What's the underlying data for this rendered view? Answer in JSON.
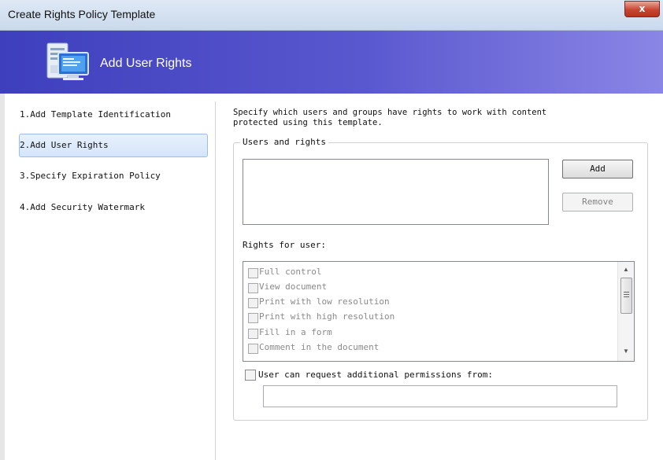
{
  "window": {
    "title": "Create Rights Policy Template",
    "close_label": "x"
  },
  "banner": {
    "title": "Add User Rights",
    "icon": "computer-list-icon"
  },
  "nav": {
    "items": [
      {
        "label": "1.Add Template Identification"
      },
      {
        "label": "2.Add User Rights",
        "selected": true
      },
      {
        "label": "3.Specify Expiration Policy"
      },
      {
        "label": "4.Add Security Watermark"
      }
    ]
  },
  "content": {
    "description_line1": "Specify which users and groups have rights to work with content",
    "description_line2": "protected using this template.",
    "users_group_label": "Users and rights",
    "add_label": "Add",
    "remove_label": "Remove",
    "rights_label": "Rights for user:",
    "rights": [
      {
        "label": "Full control",
        "checked": false
      },
      {
        "label": "View document",
        "checked": false
      },
      {
        "label": "Print with low resolution",
        "checked": false
      },
      {
        "label": "Print with high resolution",
        "checked": false
      },
      {
        "label": "Fill in a form",
        "checked": false
      },
      {
        "label": "Comment in the document",
        "checked": false
      }
    ],
    "request_label": "User can request additional permissions from:",
    "request_value": ""
  },
  "colors": {
    "banner": "#4b4ac6",
    "selection": "#d4e5fa",
    "close": "#c94532"
  }
}
